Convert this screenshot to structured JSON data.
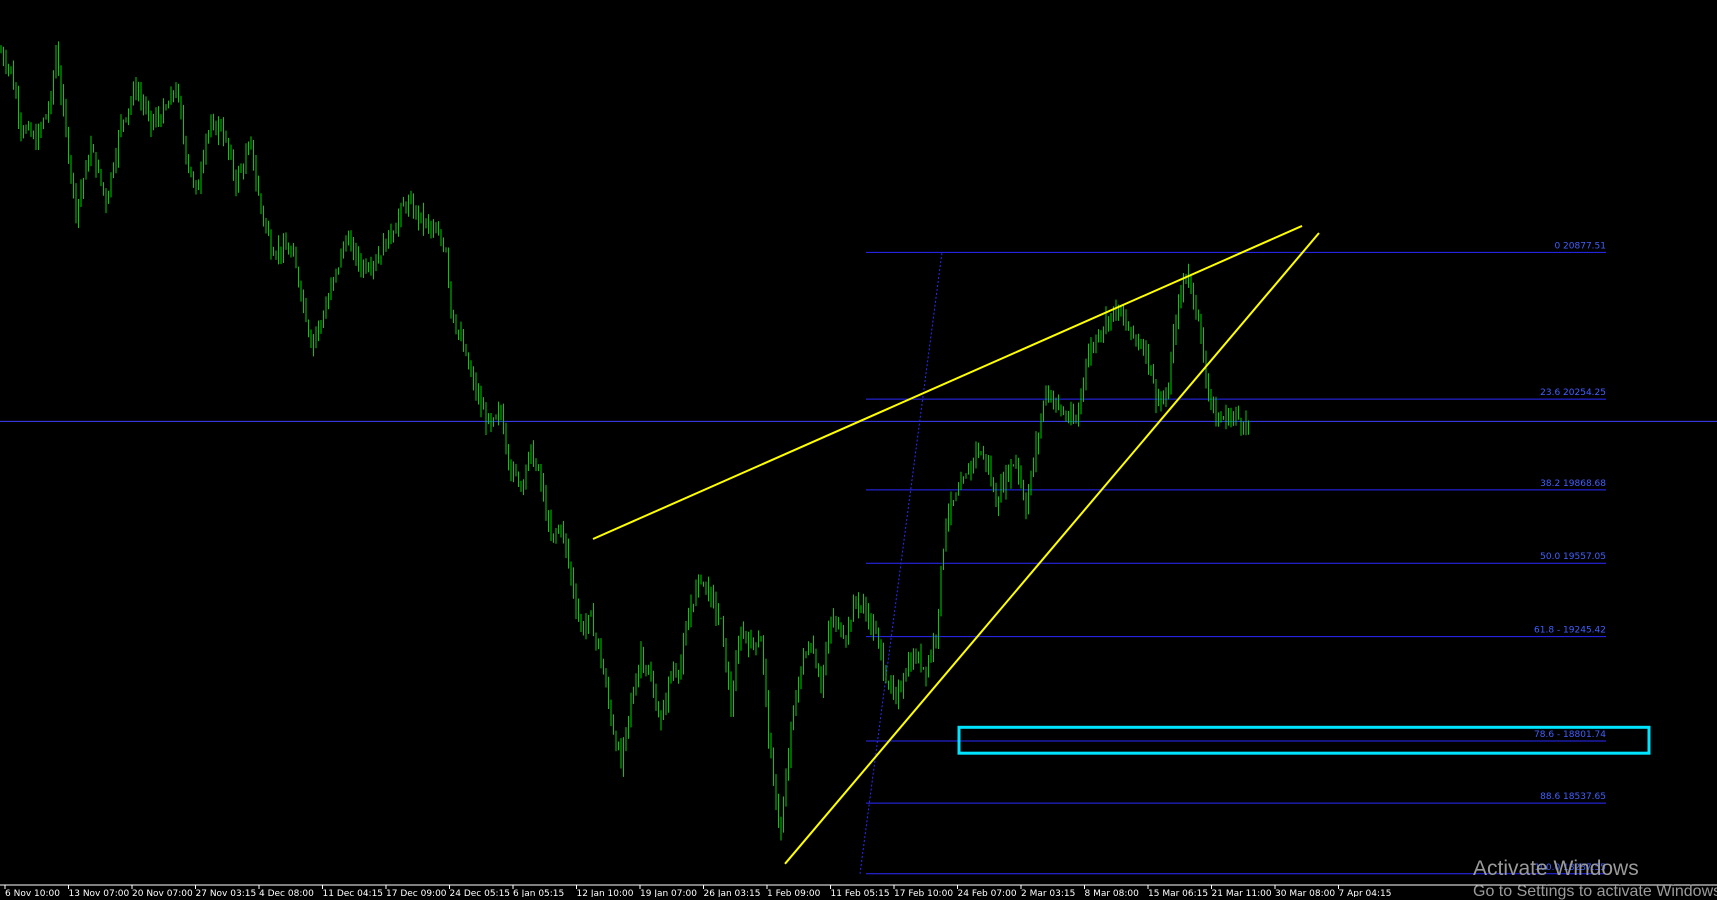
{
  "chart_data": {
    "type": "bar",
    "style": "ohlc",
    "title": "",
    "series": [],
    "colors": {
      "bars": "#00cc00",
      "trendlines": "#ffff00",
      "fib": "#2a2aff",
      "fib_text": "#4060ff",
      "zone": "#00e5ff",
      "hline": "#4040ff"
    },
    "ylim": [
      18190,
      21950
    ],
    "current_price_line": 20160,
    "grid": false,
    "x_tick_labels": [
      "6 Nov 10:00",
      "13 Nov 07:00",
      "20 Nov 07:00",
      "27 Nov 03:15",
      "4 Dec 08:00",
      "11 Dec 04:15",
      "17 Dec 09:00",
      "24 Dec 05:15",
      "6 Jan 05:15",
      "12 Jan 10:00",
      "19 Jan 07:00",
      "26 Jan 03:15",
      "1 Feb 09:00",
      "11 Feb 05:15",
      "17 Feb 10:00",
      "24 Feb 07:00",
      "2 Mar 03:15",
      "8 Mar 08:00",
      "15 Mar 06:15",
      "21 Mar 11:00",
      "30 Mar 08:00",
      "7 Apr 04:15"
    ],
    "price_path": [
      [
        0,
        21730
      ],
      [
        10,
        21650
      ],
      [
        20,
        21420
      ],
      [
        35,
        21350
      ],
      [
        50,
        21520
      ],
      [
        55,
        21740
      ],
      [
        65,
        21380
      ],
      [
        75,
        21060
      ],
      [
        90,
        21320
      ],
      [
        105,
        21100
      ],
      [
        120,
        21420
      ],
      [
        135,
        21580
      ],
      [
        150,
        21420
      ],
      [
        165,
        21480
      ],
      [
        175,
        21580
      ],
      [
        185,
        21300
      ],
      [
        195,
        21120
      ],
      [
        205,
        21380
      ],
      [
        220,
        21420
      ],
      [
        235,
        21180
      ],
      [
        250,
        21330
      ],
      [
        258,
        21100
      ],
      [
        270,
        20900
      ],
      [
        290,
        20880
      ],
      [
        300,
        20720
      ],
      [
        310,
        20500
      ],
      [
        320,
        20580
      ],
      [
        335,
        20790
      ],
      [
        345,
        20940
      ],
      [
        360,
        20820
      ],
      [
        375,
        20850
      ],
      [
        390,
        20960
      ],
      [
        405,
        21090
      ],
      [
        420,
        21020
      ],
      [
        435,
        20950
      ],
      [
        445,
        20900
      ],
      [
        450,
        20640
      ],
      [
        460,
        20500
      ],
      [
        470,
        20350
      ],
      [
        480,
        20220
      ],
      [
        490,
        20130
      ],
      [
        500,
        20200
      ],
      [
        510,
        19950
      ],
      [
        520,
        19900
      ],
      [
        530,
        20030
      ],
      [
        540,
        19900
      ],
      [
        550,
        19650
      ],
      [
        560,
        19720
      ],
      [
        570,
        19500
      ],
      [
        580,
        19280
      ],
      [
        590,
        19320
      ],
      [
        600,
        19150
      ],
      [
        610,
        18900
      ],
      [
        620,
        18700
      ],
      [
        630,
        18960
      ],
      [
        640,
        19180
      ],
      [
        650,
        19050
      ],
      [
        660,
        18880
      ],
      [
        670,
        19090
      ],
      [
        680,
        19130
      ],
      [
        690,
        19380
      ],
      [
        700,
        19500
      ],
      [
        710,
        19410
      ],
      [
        720,
        19300
      ],
      [
        730,
        18950
      ],
      [
        740,
        19280
      ],
      [
        750,
        19210
      ],
      [
        760,
        19250
      ],
      [
        770,
        18700
      ],
      [
        780,
        18410
      ],
      [
        790,
        18850
      ],
      [
        800,
        19120
      ],
      [
        810,
        19230
      ],
      [
        820,
        19050
      ],
      [
        830,
        19310
      ],
      [
        845,
        19260
      ],
      [
        855,
        19400
      ],
      [
        865,
        19350
      ],
      [
        875,
        19250
      ],
      [
        885,
        19080
      ],
      [
        895,
        18960
      ],
      [
        905,
        19120
      ],
      [
        915,
        19160
      ],
      [
        925,
        19110
      ],
      [
        935,
        19260
      ],
      [
        945,
        19760
      ],
      [
        955,
        19830
      ],
      [
        965,
        19920
      ],
      [
        975,
        20040
      ],
      [
        985,
        20000
      ],
      [
        995,
        19820
      ],
      [
        1005,
        19930
      ],
      [
        1015,
        20000
      ],
      [
        1025,
        19800
      ],
      [
        1035,
        20050
      ],
      [
        1045,
        20300
      ],
      [
        1060,
        20200
      ],
      [
        1075,
        20150
      ],
      [
        1085,
        20420
      ],
      [
        1100,
        20560
      ],
      [
        1115,
        20640
      ],
      [
        1130,
        20530
      ],
      [
        1145,
        20470
      ],
      [
        1155,
        20270
      ],
      [
        1165,
        20230
      ],
      [
        1175,
        20600
      ],
      [
        1185,
        20800
      ],
      [
        1195,
        20660
      ],
      [
        1205,
        20350
      ],
      [
        1215,
        20160
      ],
      [
        1225,
        20180
      ],
      [
        1235,
        20180
      ],
      [
        1245,
        20150
      ],
      [
        1249,
        20100
      ]
    ],
    "trendlines": [
      {
        "name": "upper",
        "points": [
          [
            593,
            19660
          ],
          [
            1302,
            20990
          ]
        ]
      },
      {
        "name": "lower",
        "points": [
          [
            785,
            18280
          ],
          [
            1319,
            20960
          ]
        ]
      }
    ],
    "fib_levels": [
      {
        "label": "0 20877.51",
        "value": 20877.51
      },
      {
        "label": "23.6 20254.25",
        "value": 20254.25
      },
      {
        "label": "38.2 19868.68",
        "value": 19868.68
      },
      {
        "label": "50.0 19557.05",
        "value": 19557.05
      },
      {
        "label": "61.8 - 19245.42",
        "value": 19245.42
      },
      {
        "label": "78.6 - 18801.74",
        "value": 18801.74
      },
      {
        "label": "88.6 18537.65",
        "value": 18537.65
      },
      {
        "label": "100.0 18237.55",
        "value": 18237.55
      }
    ],
    "zone": {
      "from": 18750,
      "to": 18860
    }
  },
  "watermark": {
    "line1": "Activate Windows",
    "line2": "Go to Settings to activate Windows."
  }
}
